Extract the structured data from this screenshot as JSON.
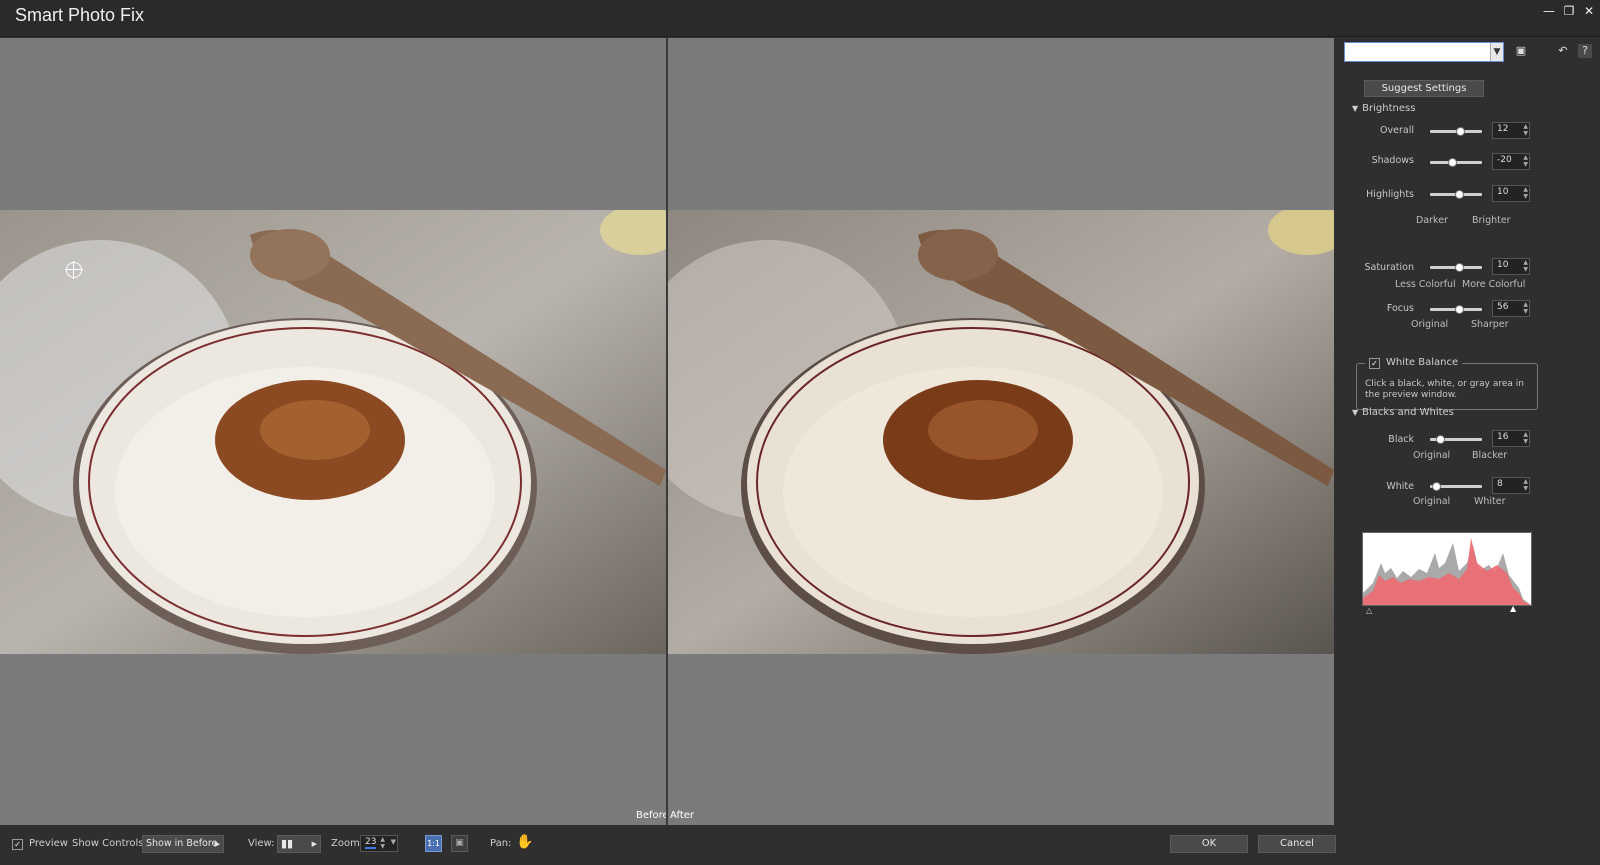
{
  "window": {
    "title": "Smart Photo Fix"
  },
  "preview": {
    "before_label": "Before",
    "after_label": "After"
  },
  "panel": {
    "suggest_label": "Suggest Settings",
    "brightness": {
      "heading": "Brightness",
      "overall": {
        "label": "Overall",
        "value": "12",
        "level": 0.58
      },
      "shadows": {
        "label": "Shadows",
        "value": "-20",
        "level": 0.42
      },
      "highlights": {
        "label": "Highlights",
        "value": "10",
        "level": 0.56
      },
      "low_label": "Darker",
      "high_label": "Brighter"
    },
    "saturation": {
      "label": "Saturation",
      "value": "10",
      "level": 0.56,
      "low_label": "Less Colorful",
      "high_label": "More Colorful"
    },
    "focus": {
      "label": "Focus",
      "value": "56",
      "level": 0.56,
      "low_label": "Original",
      "high_label": "Sharper"
    },
    "white_balance": {
      "label": "White Balance",
      "checked": true,
      "hint": "Click a black, white, or gray area in the preview window."
    },
    "blacks_whites": {
      "heading": "Blacks and Whites",
      "black": {
        "label": "Black",
        "value": "16",
        "level": 0.2,
        "low_label": "Original",
        "high_label": "Blacker"
      },
      "white": {
        "label": "White",
        "value": "8",
        "level": 0.12,
        "low_label": "Original",
        "high_label": "Whiter"
      }
    }
  },
  "bottom": {
    "preview_label": "Preview",
    "preview_checked": true,
    "show_controls_label": "Show Controls:",
    "show_controls_value": "Show in Before",
    "view_label": "View:",
    "zoom_label": "Zoom:",
    "zoom_value": "23",
    "pan_label": "Pan:",
    "ok_label": "OK",
    "cancel_label": "Cancel"
  },
  "icons": [
    "minimize-icon",
    "restore-icon",
    "close-icon",
    "save-preset-icon",
    "reset-icon",
    "help-icon",
    "crosshair-icon",
    "pan-hand-icon",
    "actual-size-icon",
    "fit-icon",
    "view-split-icon"
  ]
}
